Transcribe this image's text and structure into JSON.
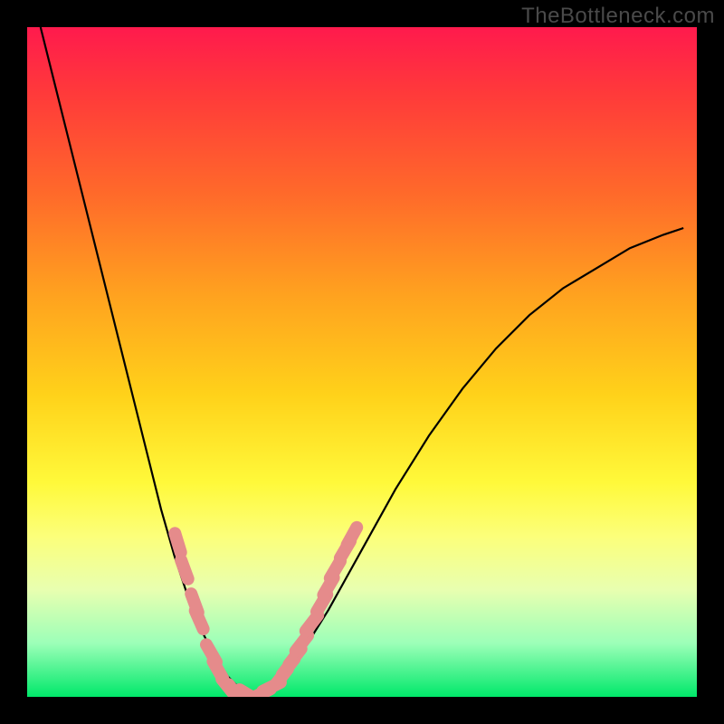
{
  "watermark": "TheBottleneck.com",
  "chart_data": {
    "type": "line",
    "title": "",
    "xlabel": "",
    "ylabel": "",
    "xlim": [
      0,
      100
    ],
    "ylim": [
      0,
      100
    ],
    "curve": {
      "name": "bottleneck-curve",
      "x": [
        2,
        4,
        6,
        8,
        10,
        12,
        14,
        16,
        18,
        20,
        22,
        24,
        26,
        28,
        30,
        32,
        35,
        40,
        45,
        50,
        55,
        60,
        65,
        70,
        75,
        80,
        85,
        90,
        95,
        98
      ],
      "y": [
        100,
        92,
        84,
        76,
        68,
        60,
        52,
        44,
        36,
        28,
        21,
        15,
        10,
        6,
        3,
        1,
        0,
        5,
        13,
        22,
        31,
        39,
        46,
        52,
        57,
        61,
        64,
        67,
        69,
        70
      ]
    },
    "markers": {
      "name": "data-points",
      "color": "#e58b8b",
      "points": [
        {
          "x": 22.5,
          "y": 23
        },
        {
          "x": 23.5,
          "y": 19
        },
        {
          "x": 25,
          "y": 14
        },
        {
          "x": 25.7,
          "y": 11.5
        },
        {
          "x": 27.5,
          "y": 6.5
        },
        {
          "x": 28.5,
          "y": 4
        },
        {
          "x": 30,
          "y": 1.5
        },
        {
          "x": 31,
          "y": 0.7
        },
        {
          "x": 33,
          "y": 0.3
        },
        {
          "x": 35,
          "y": 0.5
        },
        {
          "x": 36.5,
          "y": 1.5
        },
        {
          "x": 38,
          "y": 3
        },
        {
          "x": 39,
          "y": 4.5
        },
        {
          "x": 40,
          "y": 6
        },
        {
          "x": 41,
          "y": 8
        },
        {
          "x": 42.5,
          "y": 11
        },
        {
          "x": 44,
          "y": 14
        },
        {
          "x": 45,
          "y": 16.5
        },
        {
          "x": 46,
          "y": 19
        },
        {
          "x": 47.5,
          "y": 22
        },
        {
          "x": 48.5,
          "y": 24
        }
      ]
    }
  }
}
